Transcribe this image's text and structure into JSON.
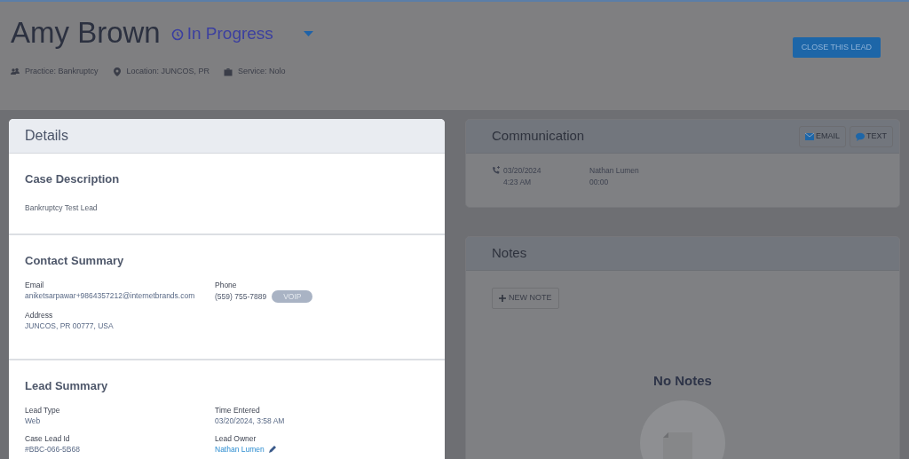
{
  "header": {
    "name": "Amy Brown",
    "status": "In Progress",
    "close_button": "CLOSE THIS LEAD",
    "meta": [
      {
        "kind": "practice",
        "text": "Practice: Bankruptcy"
      },
      {
        "kind": "location",
        "text": "Location: JUNCOS, PR"
      },
      {
        "kind": "service",
        "text": "Service: Nolo"
      }
    ]
  },
  "details": {
    "title": "Details",
    "sections": [
      {
        "title": "Case Description",
        "fields": [
          {
            "kind": "plain",
            "value": "Bankruptcy Test Lead"
          }
        ]
      },
      {
        "title": "Contact Summary",
        "fields": [
          {
            "kind": "labeled",
            "label": "Email",
            "value": "aniketsarpawar+9864357212@internetbrands.com"
          },
          {
            "kind": "phone",
            "label": "Phone",
            "value": "(559) 755-7889",
            "badge": "VOIP"
          },
          {
            "kind": "labeled",
            "label": "Address",
            "value": "JUNCOS, PR 00777, USA"
          }
        ]
      },
      {
        "title": "Lead Summary",
        "fields": [
          {
            "kind": "labeled",
            "label": "Lead Type",
            "value": "Web"
          },
          {
            "kind": "labeled",
            "label": "Time Entered",
            "value": "03/20/2024, 3:58 AM"
          },
          {
            "kind": "labeled",
            "label": "Case Lead Id",
            "value": "#BBC-066-5B68"
          },
          {
            "kind": "owner",
            "label": "Lead Owner",
            "value": "Nathan Lumen"
          }
        ]
      }
    ]
  },
  "communication": {
    "title": "Communication",
    "buttons": [
      {
        "kind": "email",
        "label": "EMAIL"
      },
      {
        "kind": "text",
        "label": "TEXT"
      }
    ],
    "calls": [
      {
        "date": "03/20/2024",
        "time": "4:23 AM",
        "agent": "Nathan Lumen",
        "duration": "00:00"
      }
    ]
  },
  "notes": {
    "title": "Notes",
    "new_button": "NEW NOTE",
    "empty_text": "No Notes"
  }
}
